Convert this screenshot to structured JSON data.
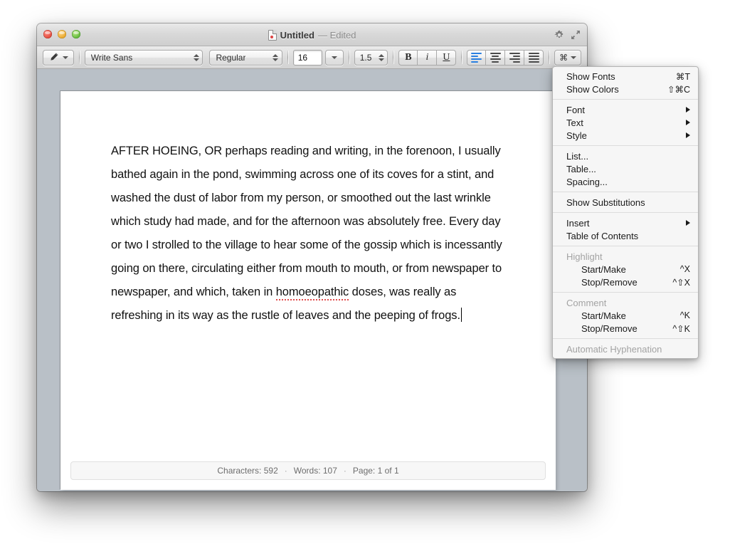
{
  "window": {
    "title": "Untitled",
    "title_status": "— Edited",
    "traffic_lights": [
      "close",
      "minimize",
      "zoom"
    ],
    "title_icons": [
      "gear-icon",
      "expand-icon"
    ]
  },
  "toolbar": {
    "pen_button": "pen-icon",
    "font_family": "Write Sans",
    "font_style": "Regular",
    "font_size": "16",
    "line_spacing": "1.5",
    "bold_label": "B",
    "italic_label": "i",
    "underline_label": "U",
    "align_left": "align-left",
    "align_center": "align-center",
    "align_right": "align-right",
    "align_justify": "align-justify",
    "cmd_glyph": "⌘",
    "accent_color": "#2a7fe0"
  },
  "document": {
    "paragraph_part1": "AFTER HOEING, OR perhaps reading and writing, in the forenoon, I usually bathed again in the pond, swimming across one of its coves for a stint, and washed the dust of labor from my person, or smoothed out the last wrinkle which study had made, and for the afternoon was absolutely free. Every day or two I strolled to the village to hear some of the gossip which is incessantly going on there, circulating either from mouth to mouth, or from newspaper to newspaper, and which, taken in ",
    "misspelled_word": "homoeopathic",
    "paragraph_part2": " doses, was really as refreshing in its way as the rustle of leaves and the peeping of frogs."
  },
  "status": {
    "characters_label": "Characters: 592",
    "separator": "·",
    "words_label": "Words: 107",
    "page_label": "Page: 1 of 1"
  },
  "menu": {
    "groups": [
      {
        "items": [
          {
            "label": "Show Fonts",
            "key": "⌘T"
          },
          {
            "label": "Show Colors",
            "key": "⇧⌘C"
          }
        ]
      },
      {
        "items": [
          {
            "label": "Font",
            "submenu": true
          },
          {
            "label": "Text",
            "submenu": true
          },
          {
            "label": "Style",
            "submenu": true
          }
        ]
      },
      {
        "items": [
          {
            "label": "List..."
          },
          {
            "label": "Table..."
          },
          {
            "label": "Spacing..."
          }
        ]
      },
      {
        "items": [
          {
            "label": "Show Substitutions"
          }
        ]
      },
      {
        "items": [
          {
            "label": "Insert",
            "submenu": true
          },
          {
            "label": "Table of Contents"
          }
        ]
      },
      {
        "header": "Highlight",
        "items": [
          {
            "label": "Start/Make",
            "key": "^X",
            "indent": true
          },
          {
            "label": "Stop/Remove",
            "key": "^⇧X",
            "indent": true
          }
        ]
      },
      {
        "header": "Comment",
        "items": [
          {
            "label": "Start/Make",
            "key": "^K",
            "indent": true
          },
          {
            "label": "Stop/Remove",
            "key": "^⇧K",
            "indent": true
          }
        ]
      },
      {
        "items": [
          {
            "label": "Automatic Hyphenation",
            "disabled": true
          }
        ]
      }
    ]
  }
}
